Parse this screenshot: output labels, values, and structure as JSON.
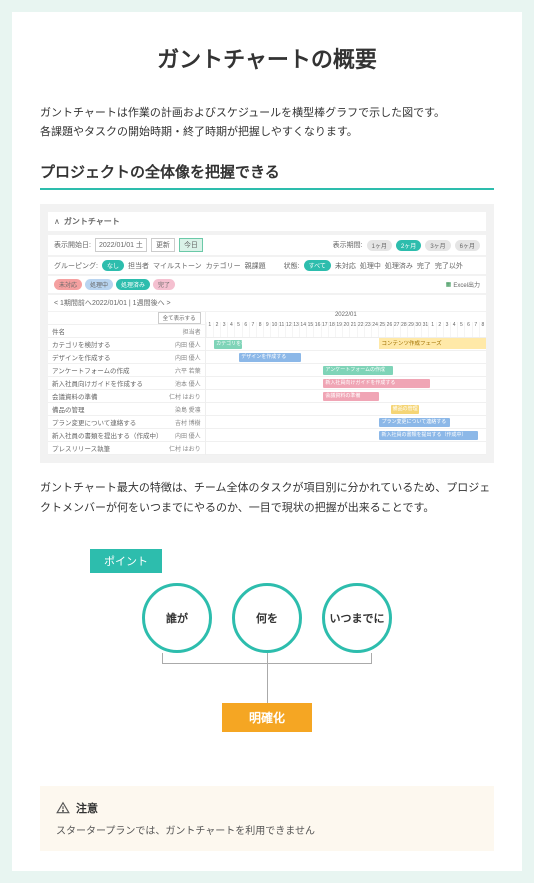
{
  "title": "ガントチャートの概要",
  "intro_line1": "ガントチャートは作業の計画およびスケジュールを横型棒グラフで示した図です。",
  "intro_line2": "各課題やタスクの開始時期・終了時期が把握しやすくなります。",
  "section_heading": "プロジェクトの全体像を把握できる",
  "gantt": {
    "chart_title": "ガントチャート",
    "start_label": "表示開始日:",
    "start_date": "2022/01/01 土",
    "update_btn": "更新",
    "today_btn": "今日",
    "range_label": "表示期間:",
    "ranges": [
      "1ヶ月",
      "2ヶ月",
      "3ヶ月",
      "6ヶ月"
    ],
    "grouping_label": "グルーピング:",
    "grouping_opts": [
      "なし",
      "担当者",
      "マイルストーン",
      "カテゴリー",
      "親課題"
    ],
    "status_label": "状態:",
    "status_opts": [
      "すべて",
      "未対応",
      "処理中",
      "処理済み",
      "完了",
      "完了以外"
    ],
    "status_tags": [
      "未対応",
      "処理中",
      "処理済み",
      "完了"
    ],
    "excel_label": "Excel出力",
    "prev_link": "< 1期間前へ",
    "reset_link": "2022/01/01 | 1週間後へ >",
    "all_expand": "全て表示する",
    "month_header": "2022/01",
    "phase_band": "コンテンツ作成フェーズ",
    "col_subject": "件名",
    "col_owner": "担当者",
    "days": [
      "1",
      "2",
      "3",
      "4",
      "5",
      "6",
      "7",
      "8",
      "9",
      "10",
      "11",
      "12",
      "13",
      "14",
      "15",
      "16",
      "17",
      "18",
      "19",
      "20",
      "21",
      "22",
      "23",
      "24",
      "25",
      "26",
      "27",
      "28",
      "29",
      "30",
      "31",
      "1",
      "2",
      "3",
      "4",
      "5",
      "6",
      "7",
      "8"
    ],
    "tasks": [
      {
        "name": "カテゴリを検討する",
        "owner": "内田 優人"
      },
      {
        "name": "デザインを作成する",
        "owner": "内田 優人"
      },
      {
        "name": "アンケートフォームの作成",
        "owner": "六平 若葉"
      },
      {
        "name": "新入社員向けガイドを作成する",
        "owner": "池本 優人"
      },
      {
        "name": "会議資料の準備",
        "owner": "仁村 はおり"
      },
      {
        "name": "備品の管理",
        "owner": "染島 愛凛"
      },
      {
        "name": "プラン変更について連絡する",
        "owner": "吉村 博樹"
      },
      {
        "name": "新入社員の書類を提出する（作成中）",
        "owner": "内田 優人"
      },
      {
        "name": "プレスリリース執筆",
        "owner": "仁村 はおり"
      }
    ],
    "bars": {
      "b1": "カテゴリを検討する",
      "b2": "デザインを作成する",
      "b3": "アンケートフォームの作成",
      "b4": "新入社員向けガイドを作成する",
      "b5": "会議資料の準備",
      "b6": "備品の管理",
      "b7": "プラン変更について連絡する",
      "b8": "新入社員の書類を提出する（作成中）"
    }
  },
  "description": "ガントチャート最大の特徴は、チーム全体のタスクが項目別に分かれているため、プロジェクトメンバーが何をいつまでにやるのか、一目で現状の把握が出来ることです。",
  "diagram": {
    "point": "ポイント",
    "who": "誰が",
    "what": "何を",
    "when": "いつまでに",
    "clarify": "明確化"
  },
  "warning": {
    "label": "注意",
    "text": "スタータープランでは、ガントチャートを利用できません"
  }
}
